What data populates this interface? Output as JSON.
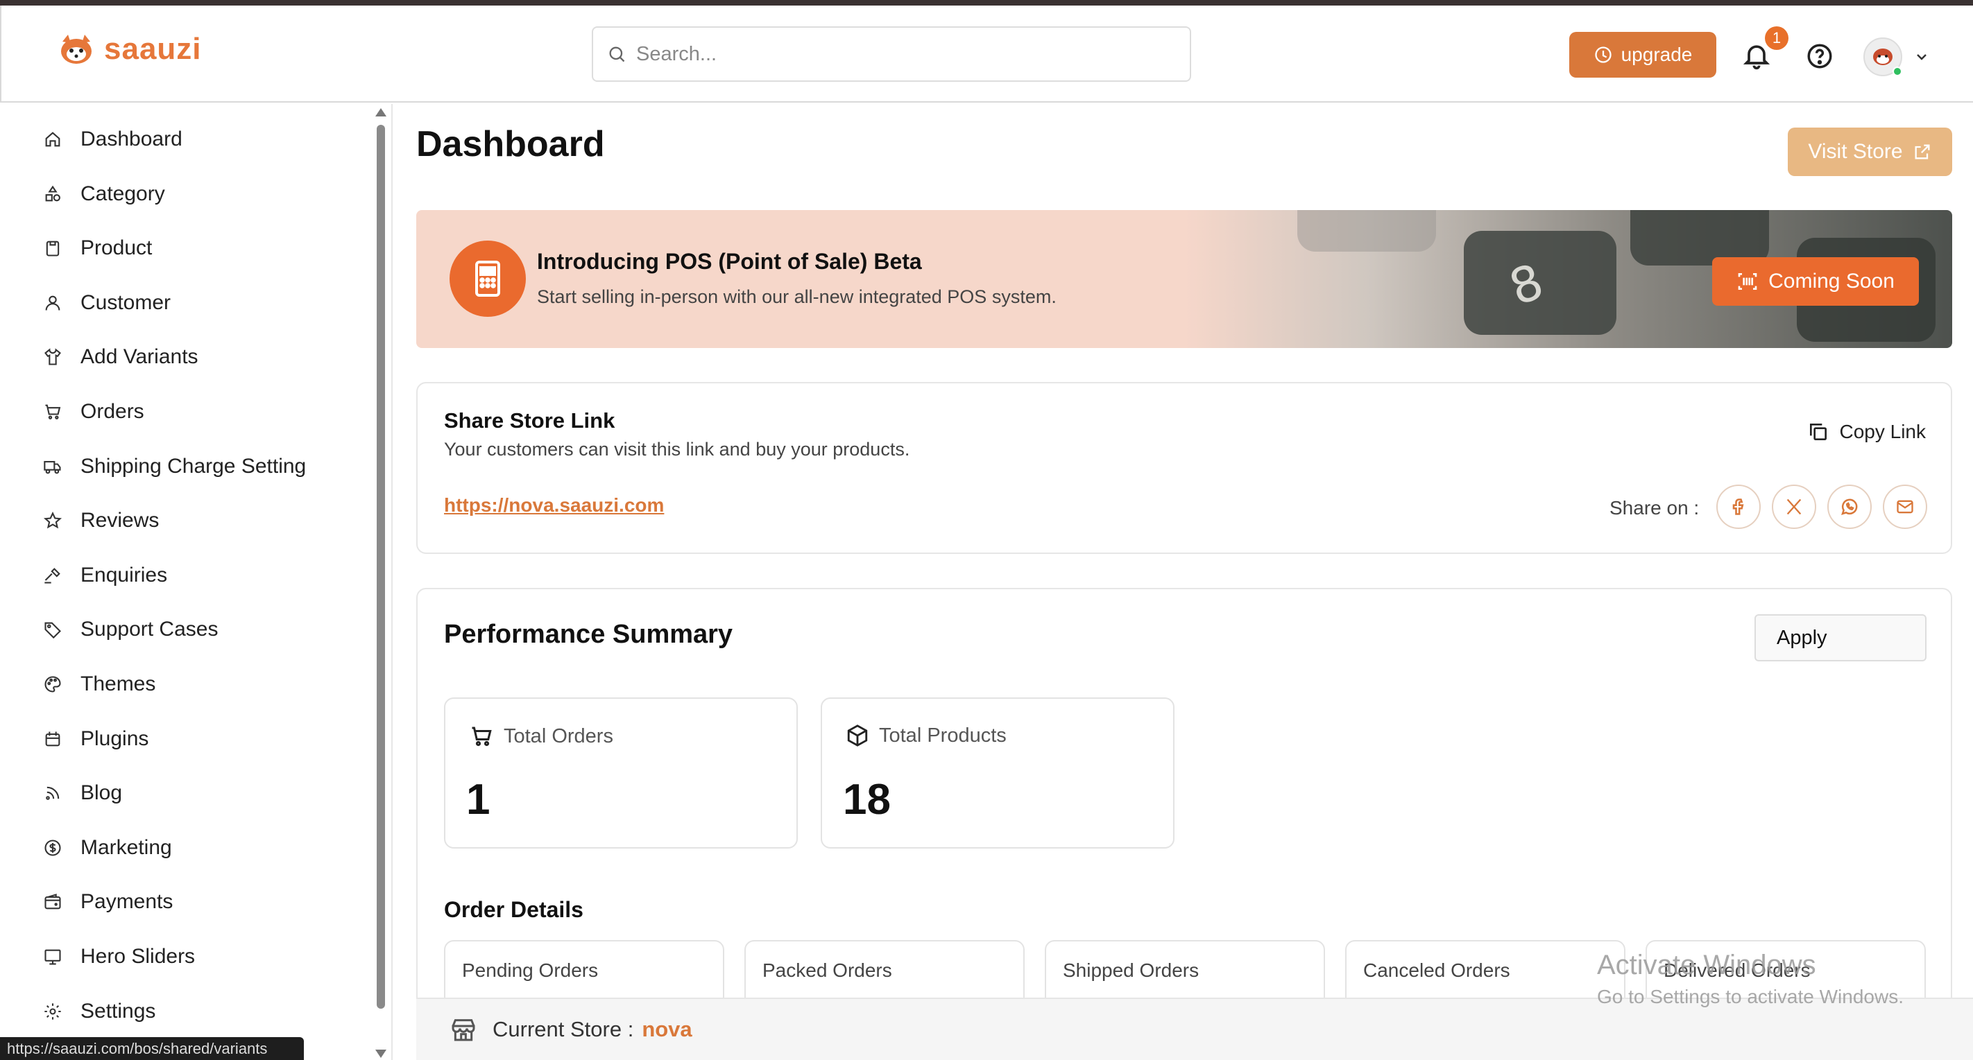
{
  "brand": {
    "name": "saauzi",
    "accent": "#d9783a"
  },
  "header": {
    "search_placeholder": "Search...",
    "upgrade_label": "upgrade",
    "notification_count": "1"
  },
  "sidebar": {
    "items": [
      {
        "label": "Dashboard",
        "icon": "home-icon"
      },
      {
        "label": "Category",
        "icon": "shapes-icon"
      },
      {
        "label": "Product",
        "icon": "box-icon"
      },
      {
        "label": "Customer",
        "icon": "user-icon"
      },
      {
        "label": "Add Variants",
        "icon": "shirt-icon"
      },
      {
        "label": "Orders",
        "icon": "cart-icon"
      },
      {
        "label": "Shipping Charge Setting",
        "icon": "truck-icon"
      },
      {
        "label": "Reviews",
        "icon": "star-icon"
      },
      {
        "label": "Enquiries",
        "icon": "gavel-icon"
      },
      {
        "label": "Support Cases",
        "icon": "tag-icon"
      },
      {
        "label": "Themes",
        "icon": "palette-icon"
      },
      {
        "label": "Plugins",
        "icon": "calendar-icon"
      },
      {
        "label": "Blog",
        "icon": "rss-icon"
      },
      {
        "label": "Marketing",
        "icon": "dollar-icon"
      },
      {
        "label": "Payments",
        "icon": "wallet-icon"
      },
      {
        "label": "Hero Sliders",
        "icon": "monitor-icon"
      },
      {
        "label": "Settings",
        "icon": "gear-icon"
      }
    ]
  },
  "status_url": "https://saauzi.com/bos/shared/variants",
  "main": {
    "title": "Dashboard",
    "visit_store_label": "Visit Store",
    "pos_banner": {
      "title": "Introducing POS (Point of Sale) Beta",
      "subtitle": "Start selling in-person with our all-new integrated POS system.",
      "button_label": "Coming Soon"
    },
    "share": {
      "title": "Share Store Link",
      "subtitle": "Your customers can visit this link and buy your products.",
      "link": "https://nova.saauzi.com",
      "copy_label": "Copy Link",
      "share_on_label": "Share on :"
    },
    "performance": {
      "title": "Performance Summary",
      "apply_label": "Apply",
      "total_orders_label": "Total Orders",
      "total_orders_value": "1",
      "total_products_label": "Total Products",
      "total_products_value": "18",
      "order_details_title": "Order Details",
      "order_boxes": [
        "Pending Orders",
        "Packed Orders",
        "Shipped Orders",
        "Canceled Orders",
        "Delivered Orders"
      ]
    },
    "current_store_label": "Current Store :",
    "current_store_name": "nova"
  },
  "watermark": {
    "line1": "Activate Windows",
    "line2": "Go to Settings to activate Windows."
  }
}
